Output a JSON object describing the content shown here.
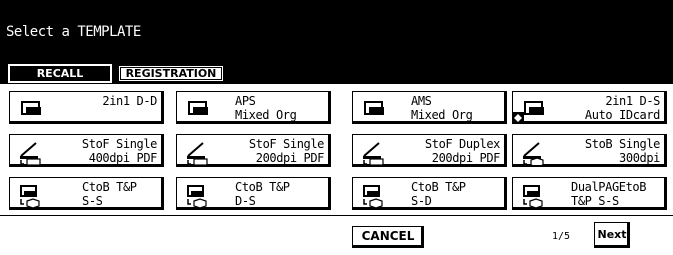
{
  "screen": {
    "title": "Select a TEMPLATE"
  },
  "tabs": {
    "recall": "RECALL",
    "registration": "REGISTRATION"
  },
  "templates": [
    {
      "line1": "2in1 D-D",
      "line2": "",
      "icon": "copy-icon"
    },
    {
      "line1": "APS",
      "line2": "Mixed Org",
      "icon": "copy-icon"
    },
    {
      "line1": "AMS",
      "line2": "Mixed Org",
      "icon": "copy-icon"
    },
    {
      "line1": "2in1 D-S",
      "line2": "Auto IDcard",
      "icon": "copy-icon"
    },
    {
      "line1": "StoF Single",
      "line2": "400dpi PDF",
      "icon": "scan-to-file-icon"
    },
    {
      "line1": "StoF Single",
      "line2": "200dpi PDF",
      "icon": "scan-to-file-icon"
    },
    {
      "line1": "StoF Duplex",
      "line2": "200dpi PDF",
      "icon": "scan-to-file-icon"
    },
    {
      "line1": "StoB Single",
      "line2": "300dpi",
      "icon": "scan-to-box-icon"
    },
    {
      "line1": "CtoB T&P",
      "line2": "S-S",
      "icon": "copy-to-box-icon"
    },
    {
      "line1": "CtoB T&P",
      "line2": "D-S",
      "icon": "copy-to-box-icon"
    },
    {
      "line1": "CtoB T&P",
      "line2": "S-D",
      "icon": "copy-to-box-icon"
    },
    {
      "line1": "DualPAGEtoB",
      "line2": "T&P S-S",
      "icon": "copy-to-box-icon"
    }
  ],
  "footer": {
    "cancel": "CANCEL",
    "page": "1/5",
    "next": "Next"
  }
}
